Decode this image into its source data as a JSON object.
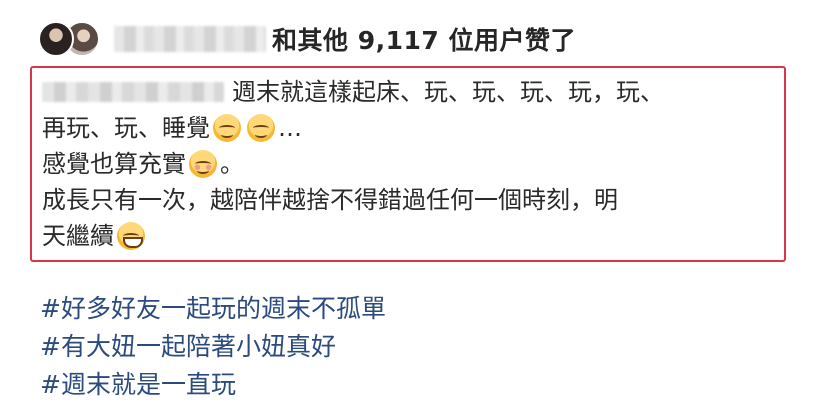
{
  "likes": {
    "text": "和其他 9,117 位用户赞了"
  },
  "caption": {
    "lines": [
      "週末就這樣起床、玩、玩、玩、玩，玩、",
      "再玩、玩、睡覺",
      "…",
      "感覺也算充實",
      "。",
      "成長只有一次，越陪伴越捨不得錯過任何一個時刻，明",
      "天繼續"
    ]
  },
  "hashtags": [
    "#好多好友一起玩的週末不孤單",
    "#有大妞一起陪著小妞真好",
    "#週末就是一直玩"
  ],
  "colors": {
    "highlight_border": "#d8344a",
    "hashtag": "#2b4b7e"
  },
  "icons": {
    "emoji_relieved": "relieved-face-emoji",
    "emoji_blush": "smiling-face-emoji",
    "emoji_grin": "grinning-face-emoji"
  }
}
